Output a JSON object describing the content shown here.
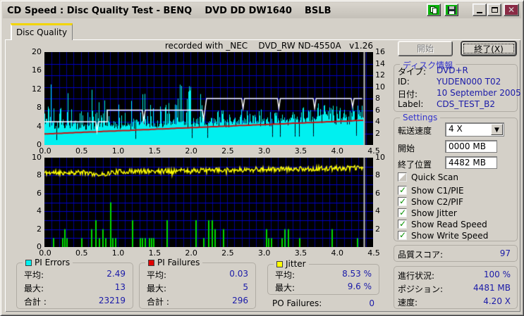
{
  "window": {
    "title": "CD Speed : Disc Quality Test - BENQ    DVD DD DW1640    BSLB"
  },
  "tabs": {
    "disc_quality": "Disc Quality"
  },
  "chart_header": "recorded with _NEC    DVD_RW ND-4550A   v1.26",
  "buttons": {
    "start": "開始",
    "exit": "終了(X)"
  },
  "disc_info": {
    "title": "ディスク情報",
    "type_label": "タイプ:",
    "type_value": "DVD+R",
    "id_label": "ID:",
    "id_value": "YUDEN000 T02",
    "date_label": "日付:",
    "date_value": "10 September 2005",
    "label_label": "Label:",
    "label_value": "CDS_TEST_B2"
  },
  "settings": {
    "title": "Settings",
    "speed_label": "転送速度",
    "speed_value": "4 X",
    "start_label": "開始",
    "start_value": "0000 MB",
    "end_label": "終了位置",
    "end_value": "4482 MB",
    "checkboxes": [
      {
        "label": "Quick Scan",
        "checked": false,
        "disabled": true
      },
      {
        "label": "Show C1/PIE",
        "checked": true,
        "disabled": false
      },
      {
        "label": "Show C2/PIF",
        "checked": true,
        "disabled": false
      },
      {
        "label": "Show Jitter",
        "checked": true,
        "disabled": false
      },
      {
        "label": "Show Read Speed",
        "checked": true,
        "disabled": false
      },
      {
        "label": "Show Write Speed",
        "checked": true,
        "disabled": false
      }
    ]
  },
  "quality": {
    "label": "品質スコア:",
    "value": "97"
  },
  "progress": {
    "label": "進行状況:",
    "value": "100 %",
    "position_label": "ポジション:",
    "position_value": "4481 MB",
    "speed_label": "速度:",
    "speed_value": "4.20 X"
  },
  "stats": {
    "pi_errors": {
      "title": "PI Errors",
      "avg_label": "平均:",
      "avg": "2.49",
      "max_label": "最大:",
      "max": "13",
      "total_label": "合計 :",
      "total": "23219"
    },
    "pi_failures": {
      "title": "PI Failures",
      "avg_label": "平均:",
      "avg": "0.03",
      "max_label": "最大:",
      "max": "5",
      "total_label": "合計 :",
      "total": "296"
    },
    "jitter": {
      "title": "Jitter",
      "avg_label": "平均:",
      "avg": "8.53 %",
      "max_label": "最大:",
      "max": "9.6 %"
    },
    "po_failures": {
      "label": "PO Failures:",
      "value": "0"
    }
  },
  "colors": {
    "pi_errors": "#00f0f0",
    "pi_failures": "#e00000",
    "jitter": "#ffff00",
    "pif_bars": "#00dc00",
    "grid_v": "#000090",
    "grid_h": "#0000c8",
    "read_speed": "#cc1010",
    "write_speed": "#ffffff",
    "chart_bg": "#000000",
    "position_marker": "#c0c0c0",
    "values_text": "#1a1aa8"
  },
  "charts": {
    "x_ticks": [
      "0.0",
      "0.5",
      "1.0",
      "1.5",
      "2.0",
      "2.5",
      "3.0",
      "3.5",
      "4.0",
      "4.5"
    ],
    "x_max": 4.5,
    "data_end": 4.37,
    "top": {
      "title": "PI Errors / Speed",
      "left_ticks": [
        20,
        16,
        12,
        8,
        4,
        0
      ],
      "left_max": 20,
      "right_ticks": [
        16,
        14,
        12,
        10,
        8,
        6,
        4,
        2
      ],
      "right_max": 16,
      "read_speed_line": {
        "start": 1.9,
        "end": 4.25
      },
      "write_speed_points": [
        [
          0,
          4
        ],
        [
          0.7,
          4
        ],
        [
          0.72,
          2.3
        ],
        [
          0.74,
          4
        ],
        [
          0.86,
          4
        ],
        [
          0.861,
          6
        ],
        [
          1.34,
          6
        ],
        [
          1.36,
          4.1
        ],
        [
          1.38,
          6
        ],
        [
          2.16,
          6
        ],
        [
          2.18,
          4.4
        ],
        [
          2.22,
          8
        ],
        [
          2.7,
          8
        ],
        [
          2.72,
          6.3
        ],
        [
          2.74,
          8
        ],
        [
          3.19,
          8
        ],
        [
          3.21,
          6.3
        ],
        [
          3.23,
          8
        ],
        [
          3.68,
          8
        ],
        [
          3.7,
          6.3
        ],
        [
          3.72,
          8
        ],
        [
          4.2,
          8
        ],
        [
          4.22,
          6.6
        ],
        [
          4.24,
          8
        ],
        [
          4.35,
          8
        ]
      ],
      "bars_seed": 7
    },
    "bottom": {
      "title": "PI Failures / Jitter",
      "left_ticks": [
        10,
        8,
        6,
        4,
        2,
        0
      ],
      "left_max": 10,
      "right_ticks": [
        10,
        8,
        6,
        4,
        2
      ],
      "right_max": 10,
      "jitter_line": {
        "mean_start": 8.3,
        "mean_end": 8.85,
        "noise": 0.55,
        "seed": 11
      },
      "pif_bars": [
        [
          0.12,
          1
        ],
        [
          0.24,
          1
        ],
        [
          0.27,
          2
        ],
        [
          0.3,
          1
        ],
        [
          0.5,
          1
        ],
        [
          0.64,
          2
        ],
        [
          0.7,
          3
        ],
        [
          0.74,
          1
        ],
        [
          0.79,
          2
        ],
        [
          0.83,
          1
        ],
        [
          0.9,
          5
        ],
        [
          0.93,
          1
        ],
        [
          0.97,
          1
        ],
        [
          1.2,
          3
        ],
        [
          1.3,
          1
        ],
        [
          1.33,
          1
        ],
        [
          1.37,
          1
        ],
        [
          1.43,
          1
        ],
        [
          1.46,
          1
        ],
        [
          1.49,
          1
        ],
        [
          1.67,
          3
        ],
        [
          2.07,
          3
        ],
        [
          2.17,
          1
        ],
        [
          2.24,
          3
        ],
        [
          2.29,
          3
        ],
        [
          2.33,
          2
        ],
        [
          2.44,
          2
        ],
        [
          3.03,
          2
        ],
        [
          3.06,
          1
        ],
        [
          3.1,
          1
        ],
        [
          3.24,
          1
        ],
        [
          3.28,
          2
        ],
        [
          3.33,
          2
        ],
        [
          3.49,
          1
        ],
        [
          3.93,
          2
        ],
        [
          4.28,
          1
        ]
      ]
    }
  }
}
